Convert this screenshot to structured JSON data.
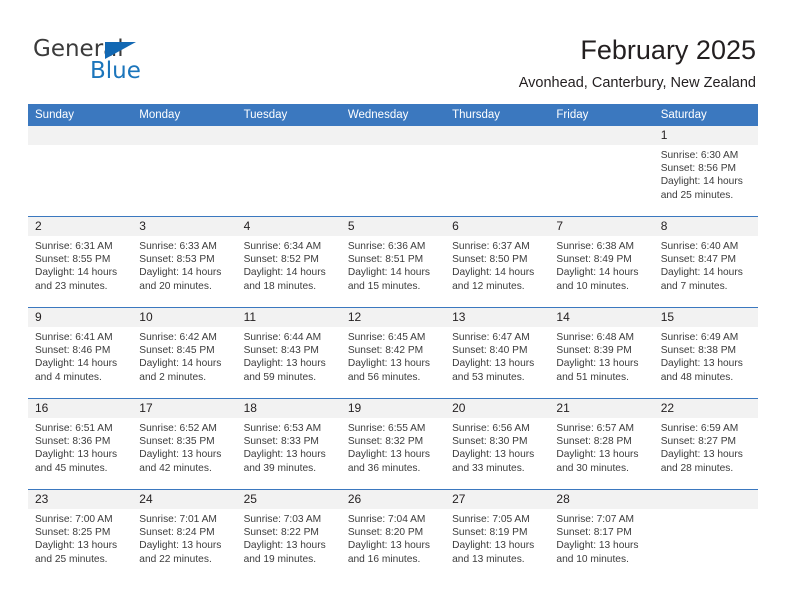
{
  "brand": {
    "name_part1": "General",
    "name_part2": "Blue",
    "triangle_color": "#1268b3",
    "blue_color": "#1b75bb"
  },
  "header": {
    "title": "February 2025",
    "subtitle": "Avonhead, Canterbury, New Zealand"
  },
  "theme": {
    "header_bg": "#3b78bf",
    "daynum_band_bg": "#f2f2f2",
    "row_border": "#3b78bf",
    "text": "#231f20"
  },
  "weekday_headers": [
    "Sunday",
    "Monday",
    "Tuesday",
    "Wednesday",
    "Thursday",
    "Friday",
    "Saturday"
  ],
  "labels": {
    "sunrise_prefix": "Sunrise: ",
    "sunset_prefix": "Sunset: ",
    "daylight_prefix": "Daylight: "
  },
  "weeks": [
    [
      {
        "day": "",
        "sunrise": "",
        "sunset": "",
        "daylight_line1": "",
        "daylight_line2": ""
      },
      {
        "day": "",
        "sunrise": "",
        "sunset": "",
        "daylight_line1": "",
        "daylight_line2": ""
      },
      {
        "day": "",
        "sunrise": "",
        "sunset": "",
        "daylight_line1": "",
        "daylight_line2": ""
      },
      {
        "day": "",
        "sunrise": "",
        "sunset": "",
        "daylight_line1": "",
        "daylight_line2": ""
      },
      {
        "day": "",
        "sunrise": "",
        "sunset": "",
        "daylight_line1": "",
        "daylight_line2": ""
      },
      {
        "day": "",
        "sunrise": "",
        "sunset": "",
        "daylight_line1": "",
        "daylight_line2": ""
      },
      {
        "day": "1",
        "sunrise": "Sunrise: 6:30 AM",
        "sunset": "Sunset: 8:56 PM",
        "daylight_line1": "Daylight: 14 hours",
        "daylight_line2": "and 25 minutes."
      }
    ],
    [
      {
        "day": "2",
        "sunrise": "Sunrise: 6:31 AM",
        "sunset": "Sunset: 8:55 PM",
        "daylight_line1": "Daylight: 14 hours",
        "daylight_line2": "and 23 minutes."
      },
      {
        "day": "3",
        "sunrise": "Sunrise: 6:33 AM",
        "sunset": "Sunset: 8:53 PM",
        "daylight_line1": "Daylight: 14 hours",
        "daylight_line2": "and 20 minutes."
      },
      {
        "day": "4",
        "sunrise": "Sunrise: 6:34 AM",
        "sunset": "Sunset: 8:52 PM",
        "daylight_line1": "Daylight: 14 hours",
        "daylight_line2": "and 18 minutes."
      },
      {
        "day": "5",
        "sunrise": "Sunrise: 6:36 AM",
        "sunset": "Sunset: 8:51 PM",
        "daylight_line1": "Daylight: 14 hours",
        "daylight_line2": "and 15 minutes."
      },
      {
        "day": "6",
        "sunrise": "Sunrise: 6:37 AM",
        "sunset": "Sunset: 8:50 PM",
        "daylight_line1": "Daylight: 14 hours",
        "daylight_line2": "and 12 minutes."
      },
      {
        "day": "7",
        "sunrise": "Sunrise: 6:38 AM",
        "sunset": "Sunset: 8:49 PM",
        "daylight_line1": "Daylight: 14 hours",
        "daylight_line2": "and 10 minutes."
      },
      {
        "day": "8",
        "sunrise": "Sunrise: 6:40 AM",
        "sunset": "Sunset: 8:47 PM",
        "daylight_line1": "Daylight: 14 hours",
        "daylight_line2": "and 7 minutes."
      }
    ],
    [
      {
        "day": "9",
        "sunrise": "Sunrise: 6:41 AM",
        "sunset": "Sunset: 8:46 PM",
        "daylight_line1": "Daylight: 14 hours",
        "daylight_line2": "and 4 minutes."
      },
      {
        "day": "10",
        "sunrise": "Sunrise: 6:42 AM",
        "sunset": "Sunset: 8:45 PM",
        "daylight_line1": "Daylight: 14 hours",
        "daylight_line2": "and 2 minutes."
      },
      {
        "day": "11",
        "sunrise": "Sunrise: 6:44 AM",
        "sunset": "Sunset: 8:43 PM",
        "daylight_line1": "Daylight: 13 hours",
        "daylight_line2": "and 59 minutes."
      },
      {
        "day": "12",
        "sunrise": "Sunrise: 6:45 AM",
        "sunset": "Sunset: 8:42 PM",
        "daylight_line1": "Daylight: 13 hours",
        "daylight_line2": "and 56 minutes."
      },
      {
        "day": "13",
        "sunrise": "Sunrise: 6:47 AM",
        "sunset": "Sunset: 8:40 PM",
        "daylight_line1": "Daylight: 13 hours",
        "daylight_line2": "and 53 minutes."
      },
      {
        "day": "14",
        "sunrise": "Sunrise: 6:48 AM",
        "sunset": "Sunset: 8:39 PM",
        "daylight_line1": "Daylight: 13 hours",
        "daylight_line2": "and 51 minutes."
      },
      {
        "day": "15",
        "sunrise": "Sunrise: 6:49 AM",
        "sunset": "Sunset: 8:38 PM",
        "daylight_line1": "Daylight: 13 hours",
        "daylight_line2": "and 48 minutes."
      }
    ],
    [
      {
        "day": "16",
        "sunrise": "Sunrise: 6:51 AM",
        "sunset": "Sunset: 8:36 PM",
        "daylight_line1": "Daylight: 13 hours",
        "daylight_line2": "and 45 minutes."
      },
      {
        "day": "17",
        "sunrise": "Sunrise: 6:52 AM",
        "sunset": "Sunset: 8:35 PM",
        "daylight_line1": "Daylight: 13 hours",
        "daylight_line2": "and 42 minutes."
      },
      {
        "day": "18",
        "sunrise": "Sunrise: 6:53 AM",
        "sunset": "Sunset: 8:33 PM",
        "daylight_line1": "Daylight: 13 hours",
        "daylight_line2": "and 39 minutes."
      },
      {
        "day": "19",
        "sunrise": "Sunrise: 6:55 AM",
        "sunset": "Sunset: 8:32 PM",
        "daylight_line1": "Daylight: 13 hours",
        "daylight_line2": "and 36 minutes."
      },
      {
        "day": "20",
        "sunrise": "Sunrise: 6:56 AM",
        "sunset": "Sunset: 8:30 PM",
        "daylight_line1": "Daylight: 13 hours",
        "daylight_line2": "and 33 minutes."
      },
      {
        "day": "21",
        "sunrise": "Sunrise: 6:57 AM",
        "sunset": "Sunset: 8:28 PM",
        "daylight_line1": "Daylight: 13 hours",
        "daylight_line2": "and 30 minutes."
      },
      {
        "day": "22",
        "sunrise": "Sunrise: 6:59 AM",
        "sunset": "Sunset: 8:27 PM",
        "daylight_line1": "Daylight: 13 hours",
        "daylight_line2": "and 28 minutes."
      }
    ],
    [
      {
        "day": "23",
        "sunrise": "Sunrise: 7:00 AM",
        "sunset": "Sunset: 8:25 PM",
        "daylight_line1": "Daylight: 13 hours",
        "daylight_line2": "and 25 minutes."
      },
      {
        "day": "24",
        "sunrise": "Sunrise: 7:01 AM",
        "sunset": "Sunset: 8:24 PM",
        "daylight_line1": "Daylight: 13 hours",
        "daylight_line2": "and 22 minutes."
      },
      {
        "day": "25",
        "sunrise": "Sunrise: 7:03 AM",
        "sunset": "Sunset: 8:22 PM",
        "daylight_line1": "Daylight: 13 hours",
        "daylight_line2": "and 19 minutes."
      },
      {
        "day": "26",
        "sunrise": "Sunrise: 7:04 AM",
        "sunset": "Sunset: 8:20 PM",
        "daylight_line1": "Daylight: 13 hours",
        "daylight_line2": "and 16 minutes."
      },
      {
        "day": "27",
        "sunrise": "Sunrise: 7:05 AM",
        "sunset": "Sunset: 8:19 PM",
        "daylight_line1": "Daylight: 13 hours",
        "daylight_line2": "and 13 minutes."
      },
      {
        "day": "28",
        "sunrise": "Sunrise: 7:07 AM",
        "sunset": "Sunset: 8:17 PM",
        "daylight_line1": "Daylight: 13 hours",
        "daylight_line2": "and 10 minutes."
      },
      {
        "day": "",
        "sunrise": "",
        "sunset": "",
        "daylight_line1": "",
        "daylight_line2": ""
      }
    ]
  ]
}
